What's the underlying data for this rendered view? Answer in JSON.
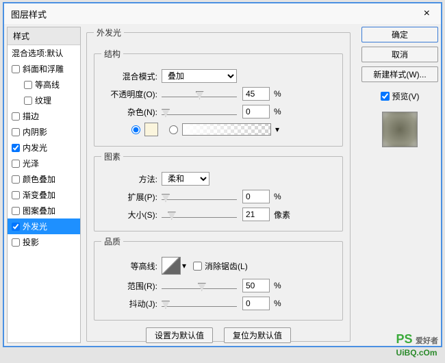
{
  "window": {
    "title": "图层样式"
  },
  "sidebar": {
    "header": "样式",
    "blending": "混合选项:默认",
    "items": [
      {
        "label": "斜面和浮雕",
        "checked": false,
        "indent": 0
      },
      {
        "label": "等高线",
        "checked": false,
        "indent": 1
      },
      {
        "label": "纹理",
        "checked": false,
        "indent": 1
      },
      {
        "label": "描边",
        "checked": false,
        "indent": 0
      },
      {
        "label": "内阴影",
        "checked": false,
        "indent": 0
      },
      {
        "label": "内发光",
        "checked": true,
        "indent": 0
      },
      {
        "label": "光泽",
        "checked": false,
        "indent": 0
      },
      {
        "label": "颜色叠加",
        "checked": false,
        "indent": 0
      },
      {
        "label": "渐变叠加",
        "checked": false,
        "indent": 0
      },
      {
        "label": "图案叠加",
        "checked": false,
        "indent": 0
      },
      {
        "label": "外发光",
        "checked": true,
        "indent": 0,
        "selected": true
      },
      {
        "label": "投影",
        "checked": false,
        "indent": 0
      }
    ]
  },
  "panel": {
    "title": "外发光",
    "structure": {
      "title": "结构",
      "blend_label": "混合模式:",
      "blend_value": "叠加",
      "opacity_label": "不透明度(O):",
      "opacity_value": "45",
      "opacity_unit": "%",
      "noise_label": "杂色(N):",
      "noise_value": "0",
      "noise_unit": "%"
    },
    "element": {
      "title": "图素",
      "technique_label": "方法:",
      "technique_value": "柔和",
      "spread_label": "扩展(P):",
      "spread_value": "0",
      "spread_unit": "%",
      "size_label": "大小(S):",
      "size_value": "21",
      "size_unit": "像素"
    },
    "quality": {
      "title": "品质",
      "contour_label": "等高线:",
      "antialias_label": "消除锯齿(L)",
      "range_label": "范围(R):",
      "range_value": "50",
      "range_unit": "%",
      "jitter_label": "抖动(J):",
      "jitter_value": "0",
      "jitter_unit": "%"
    },
    "buttons": {
      "default": "设置为默认值",
      "reset": "复位为默认值"
    }
  },
  "actions": {
    "ok": "确定",
    "cancel": "取消",
    "newstyle": "新建样式(W)...",
    "preview": "预览(V)"
  },
  "watermark": {
    "text": "UiBQ.cOm",
    "ps": "PS",
    "aihao": "爱好者"
  }
}
